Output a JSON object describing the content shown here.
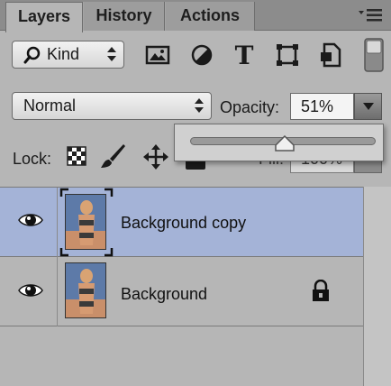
{
  "tabs": [
    {
      "label": "Layers",
      "active": true
    },
    {
      "label": "History",
      "active": false
    },
    {
      "label": "Actions",
      "active": false
    }
  ],
  "filter": {
    "kind_label": "Kind",
    "icons": [
      "image-filter-icon",
      "adjustment-filter-icon",
      "type-filter-icon",
      "shape-filter-icon",
      "smart-object-filter-icon"
    ]
  },
  "blend": {
    "mode": "Normal",
    "opacity_label": "Opacity:",
    "opacity_value": "51%",
    "opacity_slider_fraction": 0.51
  },
  "lock": {
    "label": "Lock:",
    "fill_label": "Fill:",
    "fill_value": "100%"
  },
  "layers": [
    {
      "name": "Background copy",
      "visible": true,
      "selected": true,
      "locked": false
    },
    {
      "name": "Background",
      "visible": true,
      "selected": false,
      "locked": true
    }
  ],
  "colors": {
    "selected_row": "#a4b3d7",
    "panel_bg": "#b6b6b6"
  }
}
